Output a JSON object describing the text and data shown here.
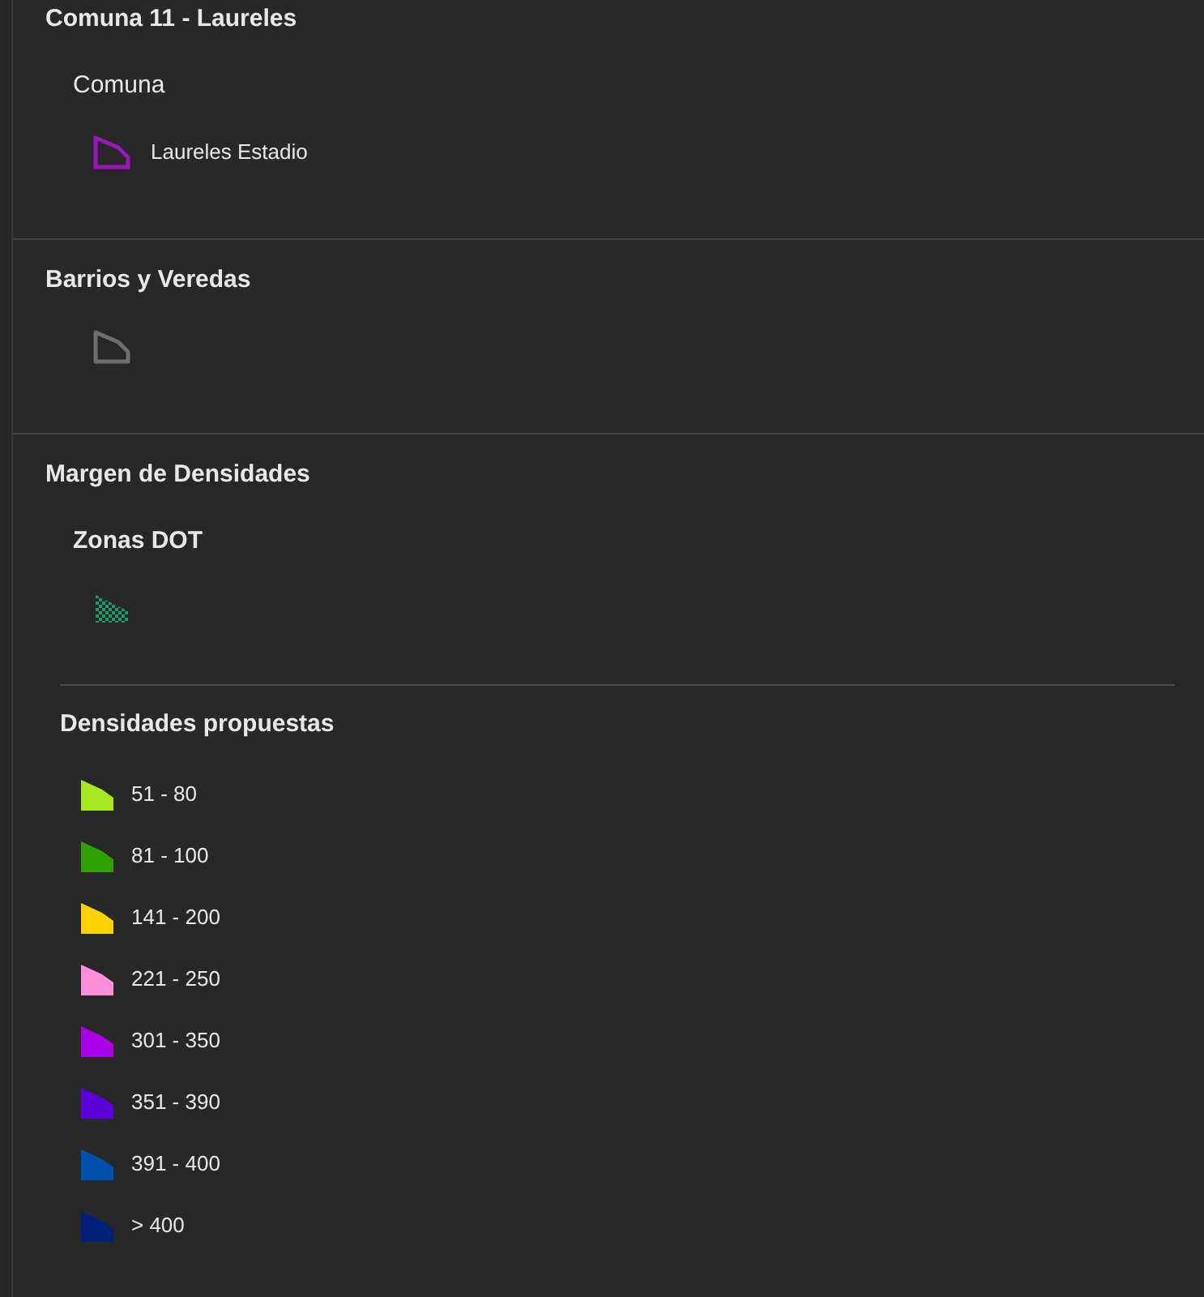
{
  "sections": [
    {
      "title": "Comuna 11 - Laureles",
      "groups": [
        {
          "subtitle": "Comuna",
          "emphasized": false,
          "items": [
            {
              "kind": "outline",
              "color": "#9a16b8",
              "label": "Laureles Estadio"
            }
          ]
        }
      ]
    },
    {
      "title": "Barrios y Veredas",
      "groups": [
        {
          "items": [
            {
              "kind": "outline",
              "color": "#6e6e6e"
            }
          ]
        }
      ]
    },
    {
      "title": "Margen de Densidades",
      "groups": [
        {
          "subtitle": "Zonas DOT",
          "emphasized": true,
          "items": [
            {
              "kind": "hatch",
              "color": "#1a9c6a"
            }
          ]
        },
        {
          "subtitle": "Densidades propuestas",
          "emphasized": true,
          "items": [
            {
              "kind": "fill",
              "color": "#a8e823",
              "label": "51 - 80"
            },
            {
              "kind": "fill",
              "color": "#2fa000",
              "label": "81 - 100"
            },
            {
              "kind": "fill",
              "color": "#ffd200",
              "label": "141 - 200"
            },
            {
              "kind": "fill",
              "color": "#ff8fd8",
              "label": "221 - 250"
            },
            {
              "kind": "fill",
              "color": "#a800e6",
              "label": "301 - 350"
            },
            {
              "kind": "fill",
              "color": "#5a00d8",
              "label": "351 - 390"
            },
            {
              "kind": "fill",
              "color": "#0050b0",
              "label": "391 - 400"
            },
            {
              "kind": "fill",
              "color": "#002078",
              "label": "> 400"
            }
          ]
        }
      ]
    }
  ]
}
